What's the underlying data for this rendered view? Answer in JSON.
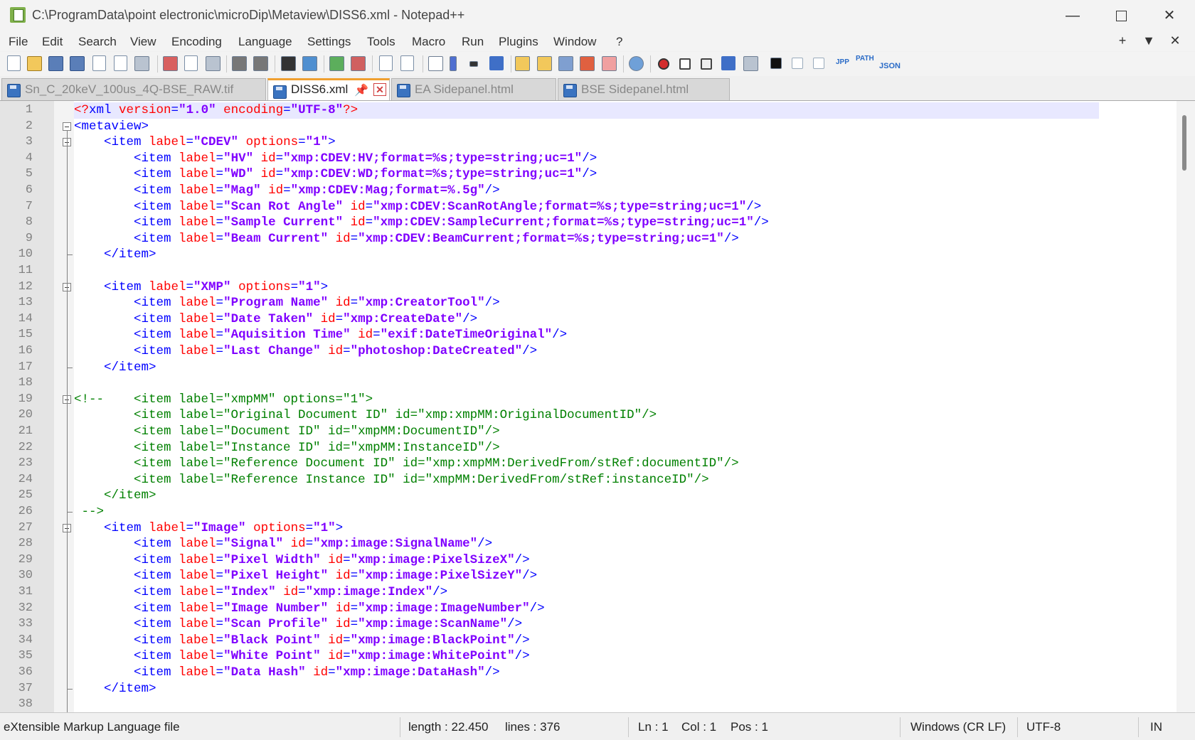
{
  "window": {
    "title": "C:\\ProgramData\\point electronic\\microDip\\Metaview\\DISS6.xml - Notepad++",
    "minimize": "—",
    "close": "✕"
  },
  "menu": {
    "items": [
      "File",
      "Edit",
      "Search",
      "View",
      "Encoding",
      "Language",
      "Settings",
      "Tools",
      "Macro",
      "Run",
      "Plugins",
      "Window",
      "?"
    ],
    "right_add": "+",
    "right_dropdown": "▼",
    "right_close": "✕"
  },
  "toolbar": {
    "macro_record_color": "#d32c2c",
    "json_label": "JSON",
    "path_label": "PATH"
  },
  "tabs": [
    {
      "label": "Sn_C_20keV_100us_4Q-BSE_RAW.tif",
      "active": false
    },
    {
      "label": "DISS6.xml",
      "active": true,
      "pin": "📌",
      "close": "✕"
    },
    {
      "label": "EA Sidepanel.html",
      "active": false
    },
    {
      "label": "BSE Sidepanel.html",
      "active": false
    }
  ],
  "editor": {
    "line_numbers": [
      "1",
      "2",
      "3",
      "4",
      "5",
      "6",
      "7",
      "8",
      "9",
      "10",
      "11",
      "12",
      "13",
      "14",
      "15",
      "16",
      "17",
      "18",
      "19",
      "20",
      "21",
      "22",
      "23",
      "24",
      "25",
      "26",
      "27",
      "28",
      "29",
      "30",
      "31",
      "32",
      "33",
      "34",
      "35",
      "36",
      "37",
      "38"
    ]
  },
  "code": [
    [
      [
        "p",
        "<?"
      ],
      [
        "t",
        "xml"
      ],
      [
        "a",
        " version"
      ],
      [
        "t",
        "="
      ],
      [
        "v",
        "\"1.0\""
      ],
      [
        "a",
        " encoding"
      ],
      [
        "t",
        "="
      ],
      [
        "v",
        "\"UTF-8\""
      ],
      [
        "p",
        "?>"
      ]
    ],
    [
      [
        "t",
        "<metaview>"
      ]
    ],
    [
      [
        "t",
        "    <item"
      ],
      [
        "a",
        " label"
      ],
      [
        "t",
        "="
      ],
      [
        "v",
        "\"CDEV\""
      ],
      [
        "a",
        " options"
      ],
      [
        "t",
        "="
      ],
      [
        "v",
        "\"1\""
      ],
      [
        "t",
        ">"
      ]
    ],
    [
      [
        "t",
        "        <item"
      ],
      [
        "a",
        " label"
      ],
      [
        "t",
        "="
      ],
      [
        "v",
        "\"HV\""
      ],
      [
        "a",
        " id"
      ],
      [
        "t",
        "="
      ],
      [
        "v",
        "\"xmp:CDEV:HV;format=%s;type=string;uc=1\""
      ],
      [
        "t",
        "/>"
      ]
    ],
    [
      [
        "t",
        "        <item"
      ],
      [
        "a",
        " label"
      ],
      [
        "t",
        "="
      ],
      [
        "v",
        "\"WD\""
      ],
      [
        "a",
        " id"
      ],
      [
        "t",
        "="
      ],
      [
        "v",
        "\"xmp:CDEV:WD;format=%s;type=string;uc=1\""
      ],
      [
        "t",
        "/>"
      ]
    ],
    [
      [
        "t",
        "        <item"
      ],
      [
        "a",
        " label"
      ],
      [
        "t",
        "="
      ],
      [
        "v",
        "\"Mag\""
      ],
      [
        "a",
        " id"
      ],
      [
        "t",
        "="
      ],
      [
        "v",
        "\"xmp:CDEV:Mag;format=%.5g\""
      ],
      [
        "t",
        "/>"
      ]
    ],
    [
      [
        "t",
        "        <item"
      ],
      [
        "a",
        " label"
      ],
      [
        "t",
        "="
      ],
      [
        "v",
        "\"Scan Rot Angle\""
      ],
      [
        "a",
        " id"
      ],
      [
        "t",
        "="
      ],
      [
        "v",
        "\"xmp:CDEV:ScanRotAngle;format=%s;type=string;uc=1\""
      ],
      [
        "t",
        "/>"
      ]
    ],
    [
      [
        "t",
        "        <item"
      ],
      [
        "a",
        " label"
      ],
      [
        "t",
        "="
      ],
      [
        "v",
        "\"Sample Current\""
      ],
      [
        "a",
        " id"
      ],
      [
        "t",
        "="
      ],
      [
        "v",
        "\"xmp:CDEV:SampleCurrent;format=%s;type=string;uc=1\""
      ],
      [
        "t",
        "/>"
      ]
    ],
    [
      [
        "t",
        "        <item"
      ],
      [
        "a",
        " label"
      ],
      [
        "t",
        "="
      ],
      [
        "v",
        "\"Beam Current\""
      ],
      [
        "a",
        " id"
      ],
      [
        "t",
        "="
      ],
      [
        "v",
        "\"xmp:CDEV:BeamCurrent;format=%s;type=string;uc=1\""
      ],
      [
        "t",
        "/>"
      ]
    ],
    [
      [
        "t",
        "    </item>"
      ]
    ],
    [],
    [
      [
        "t",
        "    <item"
      ],
      [
        "a",
        " label"
      ],
      [
        "t",
        "="
      ],
      [
        "v",
        "\"XMP\""
      ],
      [
        "a",
        " options"
      ],
      [
        "t",
        "="
      ],
      [
        "v",
        "\"1\""
      ],
      [
        "t",
        ">"
      ]
    ],
    [
      [
        "t",
        "        <item"
      ],
      [
        "a",
        " label"
      ],
      [
        "t",
        "="
      ],
      [
        "v",
        "\"Program Name\""
      ],
      [
        "a",
        " id"
      ],
      [
        "t",
        "="
      ],
      [
        "v",
        "\"xmp:CreatorTool\""
      ],
      [
        "t",
        "/>"
      ]
    ],
    [
      [
        "t",
        "        <item"
      ],
      [
        "a",
        " label"
      ],
      [
        "t",
        "="
      ],
      [
        "v",
        "\"Date Taken\""
      ],
      [
        "a",
        " id"
      ],
      [
        "t",
        "="
      ],
      [
        "v",
        "\"xmp:CreateDate\""
      ],
      [
        "t",
        "/>"
      ]
    ],
    [
      [
        "t",
        "        <item"
      ],
      [
        "a",
        " label"
      ],
      [
        "t",
        "="
      ],
      [
        "v",
        "\"Aquisition Time\""
      ],
      [
        "a",
        " id"
      ],
      [
        "t",
        "="
      ],
      [
        "v",
        "\"exif:DateTimeOriginal\""
      ],
      [
        "t",
        "/>"
      ]
    ],
    [
      [
        "t",
        "        <item"
      ],
      [
        "a",
        " label"
      ],
      [
        "t",
        "="
      ],
      [
        "v",
        "\"Last Change\""
      ],
      [
        "a",
        " id"
      ],
      [
        "t",
        "="
      ],
      [
        "v",
        "\"photoshop:DateCreated\""
      ],
      [
        "t",
        "/>"
      ]
    ],
    [
      [
        "t",
        "    </item>"
      ]
    ],
    [],
    [
      [
        "c",
        "<!--    <item label=\"xmpMM\" options=\"1\">"
      ]
    ],
    [
      [
        "c",
        "        <item label=\"Original Document ID\" id=\"xmp:xmpMM:OriginalDocumentID\"/>"
      ]
    ],
    [
      [
        "c",
        "        <item label=\"Document ID\" id=\"xmpMM:DocumentID\"/>"
      ]
    ],
    [
      [
        "c",
        "        <item label=\"Instance ID\" id=\"xmpMM:InstanceID\"/>"
      ]
    ],
    [
      [
        "c",
        "        <item label=\"Reference Document ID\" id=\"xmp:xmpMM:DerivedFrom/stRef:documentID\"/>"
      ]
    ],
    [
      [
        "c",
        "        <item label=\"Reference Instance ID\" id=\"xmpMM:DerivedFrom/stRef:instanceID\"/>"
      ]
    ],
    [
      [
        "c",
        "    </item>"
      ]
    ],
    [
      [
        "c",
        " -->"
      ]
    ],
    [
      [
        "t",
        "    <item"
      ],
      [
        "a",
        " label"
      ],
      [
        "t",
        "="
      ],
      [
        "v",
        "\"Image\""
      ],
      [
        "a",
        " options"
      ],
      [
        "t",
        "="
      ],
      [
        "v",
        "\"1\""
      ],
      [
        "t",
        ">"
      ]
    ],
    [
      [
        "t",
        "        <item"
      ],
      [
        "a",
        " label"
      ],
      [
        "t",
        "="
      ],
      [
        "v",
        "\"Signal\""
      ],
      [
        "a",
        " id"
      ],
      [
        "t",
        "="
      ],
      [
        "v",
        "\"xmp:image:SignalName\""
      ],
      [
        "t",
        "/>"
      ]
    ],
    [
      [
        "t",
        "        <item"
      ],
      [
        "a",
        " label"
      ],
      [
        "t",
        "="
      ],
      [
        "v",
        "\"Pixel Width\""
      ],
      [
        "a",
        " id"
      ],
      [
        "t",
        "="
      ],
      [
        "v",
        "\"xmp:image:PixelSizeX\""
      ],
      [
        "t",
        "/>"
      ]
    ],
    [
      [
        "t",
        "        <item"
      ],
      [
        "a",
        " label"
      ],
      [
        "t",
        "="
      ],
      [
        "v",
        "\"Pixel Height\""
      ],
      [
        "a",
        " id"
      ],
      [
        "t",
        "="
      ],
      [
        "v",
        "\"xmp:image:PixelSizeY\""
      ],
      [
        "t",
        "/>"
      ]
    ],
    [
      [
        "t",
        "        <item"
      ],
      [
        "a",
        " label"
      ],
      [
        "t",
        "="
      ],
      [
        "v",
        "\"Index\""
      ],
      [
        "a",
        " id"
      ],
      [
        "t",
        "="
      ],
      [
        "v",
        "\"xmp:image:Index\""
      ],
      [
        "t",
        "/>"
      ]
    ],
    [
      [
        "t",
        "        <item"
      ],
      [
        "a",
        " label"
      ],
      [
        "t",
        "="
      ],
      [
        "v",
        "\"Image Number\""
      ],
      [
        "a",
        " id"
      ],
      [
        "t",
        "="
      ],
      [
        "v",
        "\"xmp:image:ImageNumber\""
      ],
      [
        "t",
        "/>"
      ]
    ],
    [
      [
        "t",
        "        <item"
      ],
      [
        "a",
        " label"
      ],
      [
        "t",
        "="
      ],
      [
        "v",
        "\"Scan Profile\""
      ],
      [
        "a",
        " id"
      ],
      [
        "t",
        "="
      ],
      [
        "v",
        "\"xmp:image:ScanName\""
      ],
      [
        "t",
        "/>"
      ]
    ],
    [
      [
        "t",
        "        <item"
      ],
      [
        "a",
        " label"
      ],
      [
        "t",
        "="
      ],
      [
        "v",
        "\"Black Point\""
      ],
      [
        "a",
        " id"
      ],
      [
        "t",
        "="
      ],
      [
        "v",
        "\"xmp:image:BlackPoint\""
      ],
      [
        "t",
        "/>"
      ]
    ],
    [
      [
        "t",
        "        <item"
      ],
      [
        "a",
        " label"
      ],
      [
        "t",
        "="
      ],
      [
        "v",
        "\"White Point\""
      ],
      [
        "a",
        " id"
      ],
      [
        "t",
        "="
      ],
      [
        "v",
        "\"xmp:image:WhitePoint\""
      ],
      [
        "t",
        "/>"
      ]
    ],
    [
      [
        "t",
        "        <item"
      ],
      [
        "a",
        " label"
      ],
      [
        "t",
        "="
      ],
      [
        "v",
        "\"Data Hash\""
      ],
      [
        "a",
        " id"
      ],
      [
        "t",
        "="
      ],
      [
        "v",
        "\"xmp:image:DataHash\""
      ],
      [
        "t",
        "/>"
      ]
    ],
    [
      [
        "t",
        "    </item>"
      ]
    ],
    []
  ],
  "status": {
    "filetype": "eXtensible Markup Language file",
    "length": "length : 22.450",
    "lines": "lines : 376",
    "ln": "Ln : 1",
    "col": "Col : 1",
    "pos": "Pos : 1",
    "eol": "Windows (CR LF)",
    "encoding": "UTF-8",
    "mode": "IN"
  }
}
